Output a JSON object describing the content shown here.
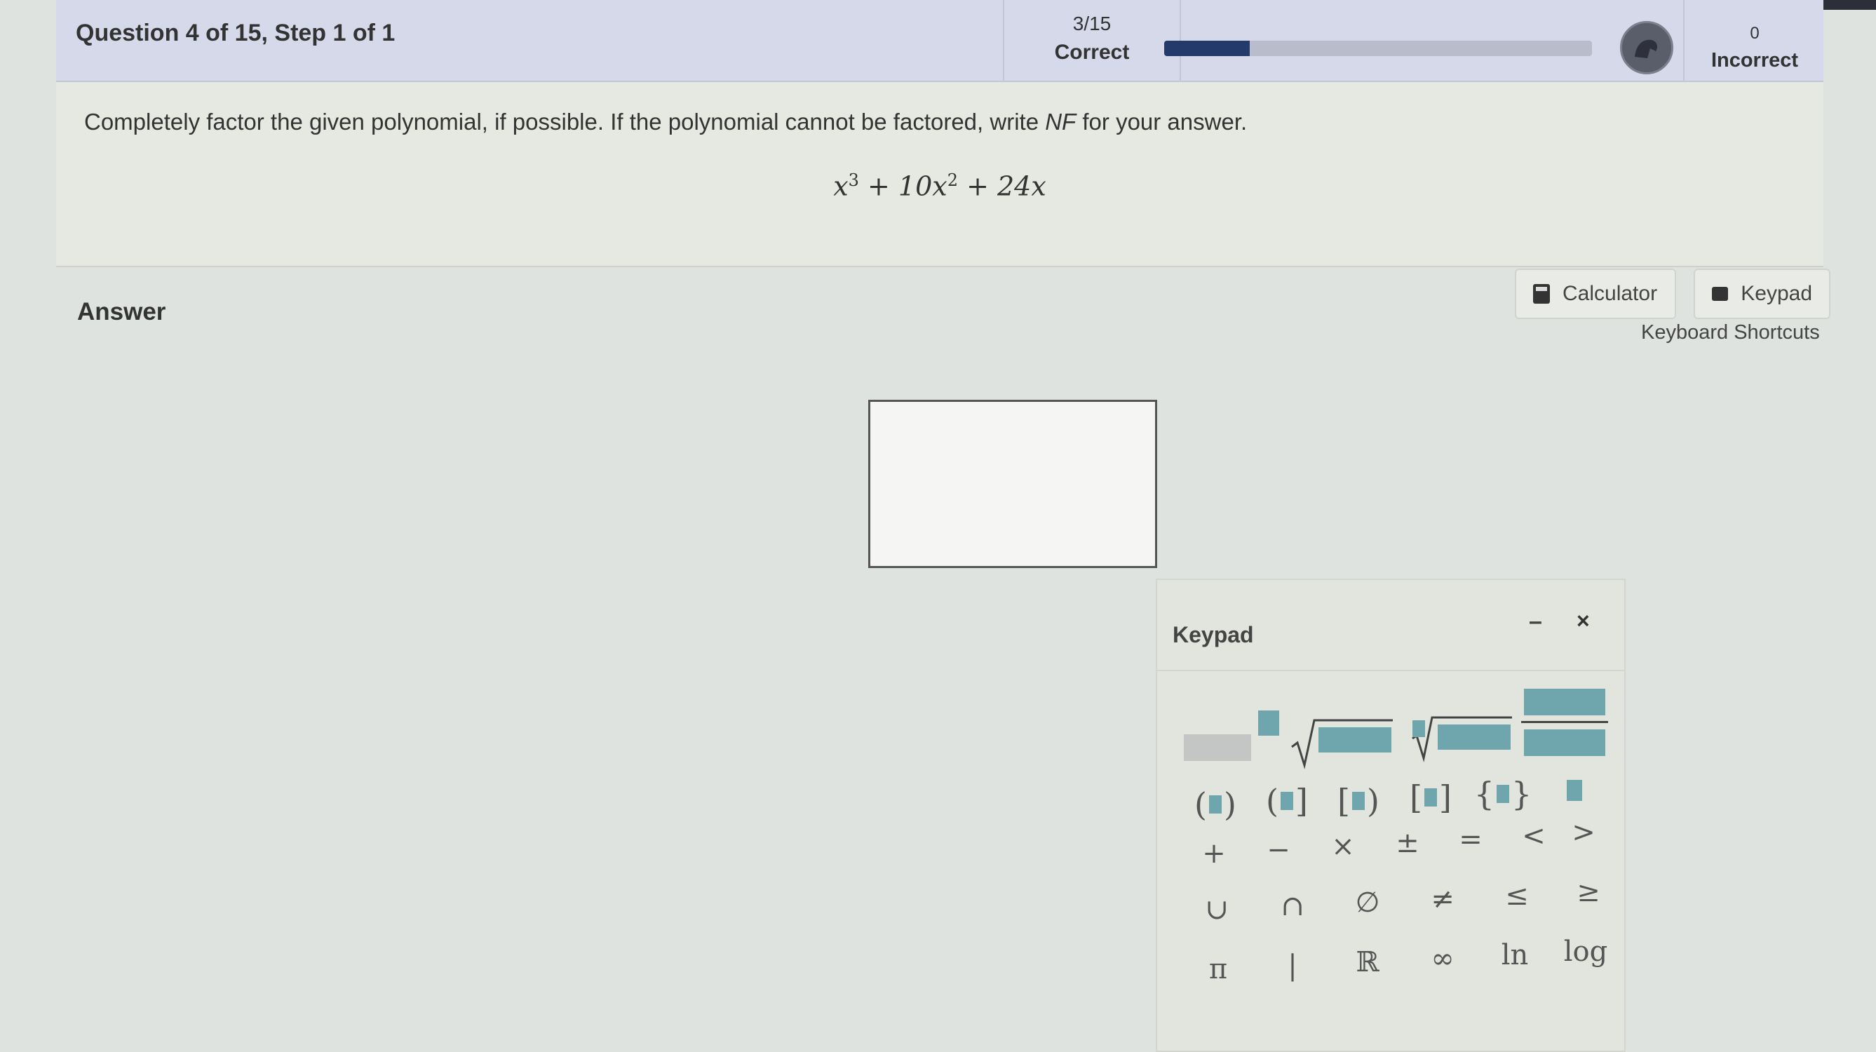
{
  "header": {
    "question_title": "Question 4 of 15,  Step 1 of 1",
    "score_value": "3/15",
    "score_label": "Correct",
    "progress_fraction": 0.2,
    "incorrect_value": "0",
    "incorrect_label": "Incorrect"
  },
  "question": {
    "instruction_before": "Completely factor the given polynomial, if possible. If the polynomial cannot be factored, write ",
    "instruction_em": "NF",
    "instruction_after": " for your answer.",
    "poly_t1": "x",
    "poly_e1": "3",
    "poly_t2": " + 10x",
    "poly_e2": "2",
    "poly_t3": " + 24x"
  },
  "answer": {
    "label": "Answer",
    "calculator_label": "Calculator",
    "keypad_label": "Keypad",
    "shortcuts_label": "Keyboard Shortcuts",
    "input_value": ""
  },
  "keypad": {
    "title": "Keypad",
    "minimize_symbol": "–",
    "close_symbol": "×",
    "row3": [
      "+",
      "−",
      "×",
      "±",
      "=",
      "<",
      ">"
    ],
    "row4": [
      "∪",
      "∩",
      "∅",
      "≠",
      "≤",
      "≥"
    ],
    "row5": [
      "π",
      "|",
      "ℝ",
      "∞",
      "ln",
      "log"
    ]
  },
  "colors": {
    "accent_teal": "#6fa6ad",
    "progress_fill": "#233a6b",
    "header_bg": "#d6d9ea"
  }
}
